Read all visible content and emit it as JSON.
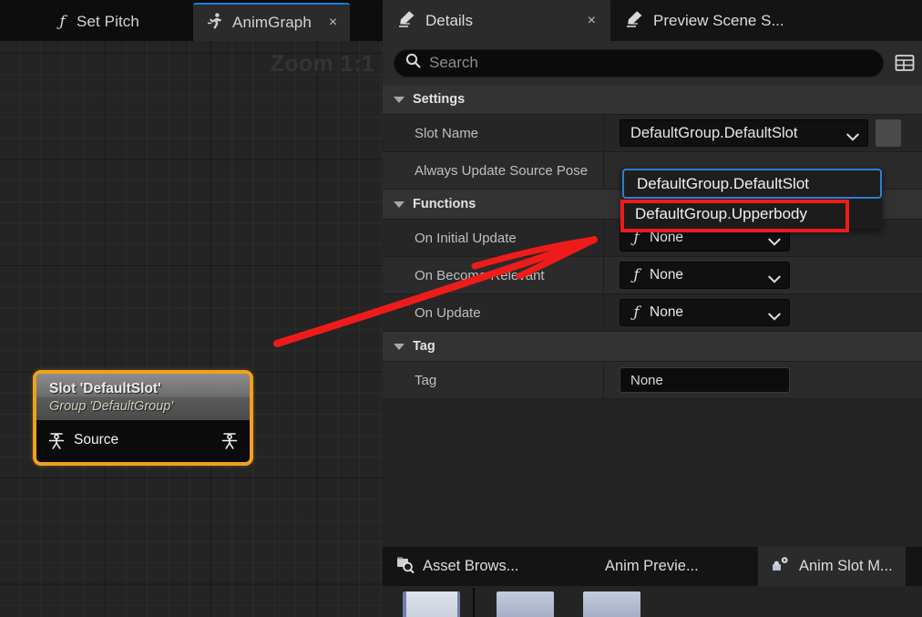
{
  "graph_editor": {
    "tabs": [
      {
        "label": "Set Pitch",
        "icon": "function-icon",
        "active": false,
        "close": ""
      },
      {
        "label": "AnimGraph",
        "icon": "anim-run-icon",
        "active": true,
        "close": "×"
      }
    ],
    "zoom_label": "Zoom 1:1",
    "node": {
      "title": "Slot 'DefaultSlot'",
      "subtitle": "Group 'DefaultGroup'",
      "input_pin_label": "Source",
      "border_color": "#f0a11c",
      "pin_icon": "pose-pin-icon"
    }
  },
  "details_panel": {
    "tabs": [
      {
        "label": "Details",
        "icon": "details-pencil-icon",
        "active": true,
        "close": "×"
      },
      {
        "label": "Preview Scene S...",
        "icon": "details-pencil-icon",
        "active": false,
        "close": ""
      }
    ],
    "search": {
      "placeholder": "Search",
      "value": "",
      "icon": "search-icon"
    },
    "settings_grid_icon": "grid-view-icon",
    "categories": [
      {
        "label": "Settings",
        "expanded": true,
        "rows": [
          {
            "name": "Slot Name",
            "type": "combo",
            "value": "DefaultGroup.DefaultSlot",
            "has_reset": true
          },
          {
            "name": "Always Update Source Pose",
            "type": "none",
            "value": ""
          }
        ]
      },
      {
        "label": "Functions",
        "expanded": true,
        "rows": [
          {
            "name": "On Initial Update",
            "type": "function",
            "value": "None"
          },
          {
            "name": "On Become Relevant",
            "type": "function",
            "value": "None"
          },
          {
            "name": "On Update",
            "type": "function",
            "value": "None"
          }
        ]
      },
      {
        "label": "Tag",
        "expanded": true,
        "rows": [
          {
            "name": "Tag",
            "type": "text",
            "value": "None"
          }
        ]
      }
    ],
    "slot_dropdown": {
      "open": true,
      "options": [
        {
          "label": "DefaultGroup.DefaultSlot",
          "highlighted": true
        },
        {
          "label": "DefaultGroup.Upperbody",
          "highlighted": false
        }
      ],
      "annotation_color": "#ee1b1b"
    }
  },
  "bottom_panel": {
    "tabs": [
      {
        "label": "Asset Brows...",
        "icon": "asset-browser-icon",
        "active": false
      },
      {
        "label": "Anim Previe...",
        "icon": "",
        "active": false
      },
      {
        "label": "Anim Slot M...",
        "icon": "anim-slot-manager-icon",
        "active": true
      }
    ]
  },
  "annotations": {
    "arrow_color": "#ee1b1b",
    "arrow_from": "slot-node",
    "arrow_to": "slot-name-dropdown"
  }
}
